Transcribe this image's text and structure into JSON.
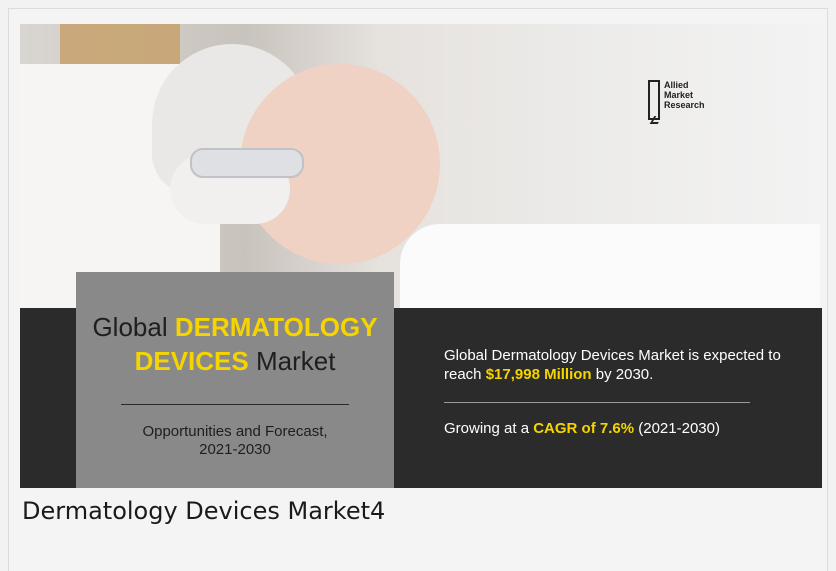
{
  "banner": {
    "logo": {
      "line1": "Allied",
      "line2": "Market",
      "line3": "Research"
    },
    "title": {
      "line1_plain": "Global ",
      "line1_highlight": "DERMATOLOGY",
      "line2_highlight": "DEVICES",
      "line2_plain": " Market",
      "subtitle_line1": "Opportunities and Forecast,",
      "subtitle_line2": "2021-2030"
    },
    "stats": {
      "expected_prefix": "Global Dermatology Devices Market is expected to reach ",
      "expected_value": "$17,998 Million",
      "expected_suffix": " by 2030.",
      "growth_prefix": "Growing at a ",
      "growth_value": "CAGR of 7.6%",
      "growth_suffix": " (2021-2030)"
    },
    "colors": {
      "highlight": "#f5d400",
      "strip": "#2b2b2b",
      "title_box": "#898989"
    }
  },
  "caption": "Dermatology Devices Market4"
}
